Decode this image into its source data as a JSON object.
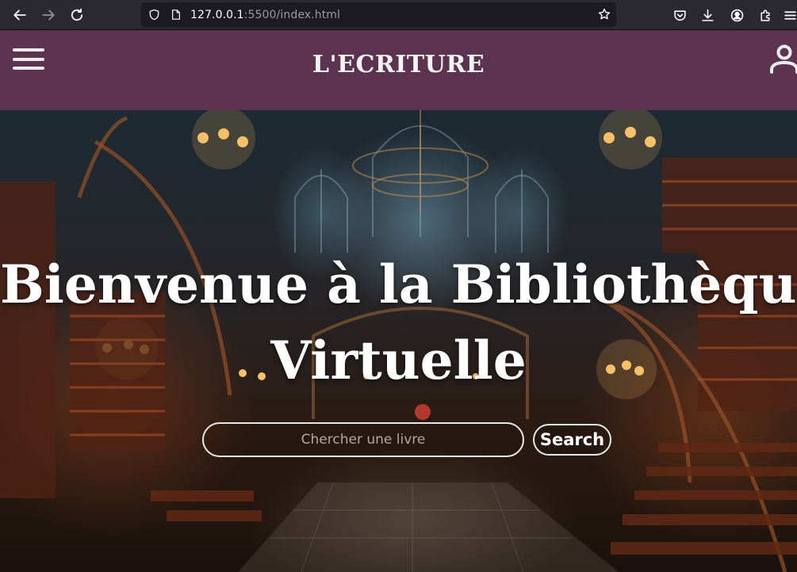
{
  "browser": {
    "url_host": "127.0.0.1",
    "url_rest": ":5500/index.html"
  },
  "header": {
    "brand": "L'ECRITURE"
  },
  "hero": {
    "title_line1": "Bienvenue à la Bibliothèque",
    "title_line2": "Virtuelle",
    "search_placeholder": "Chercher une livre",
    "search_button": "Search"
  },
  "colors": {
    "header_bg": "#5c3450",
    "browser_bg": "#2b2a33",
    "urlbar_bg": "#1c1b22"
  }
}
